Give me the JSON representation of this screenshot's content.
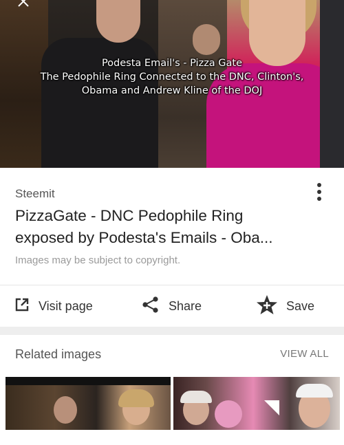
{
  "hero": {
    "caption_lines": [
      "Podesta Email's - Pizza Gate",
      "The Pedophile Ring Connected to the DNC, Clinton's,",
      "Obama and Andrew Kline of the DOJ"
    ]
  },
  "card": {
    "source": "Steemit",
    "title": "PizzaGate - DNC Pedophile Ring exposed by Podesta's Emails - Oba...",
    "copyright_note": "Images may be subject to copyright."
  },
  "actions": {
    "visit_label": "Visit page",
    "share_label": "Share",
    "save_label": "Save"
  },
  "related": {
    "title": "Related images",
    "view_all": "VIEW ALL"
  },
  "icons": {
    "close": "close-icon",
    "more": "more-vert-icon",
    "visit": "open-in-new-icon",
    "share": "share-icon",
    "save": "star-plus-icon"
  }
}
